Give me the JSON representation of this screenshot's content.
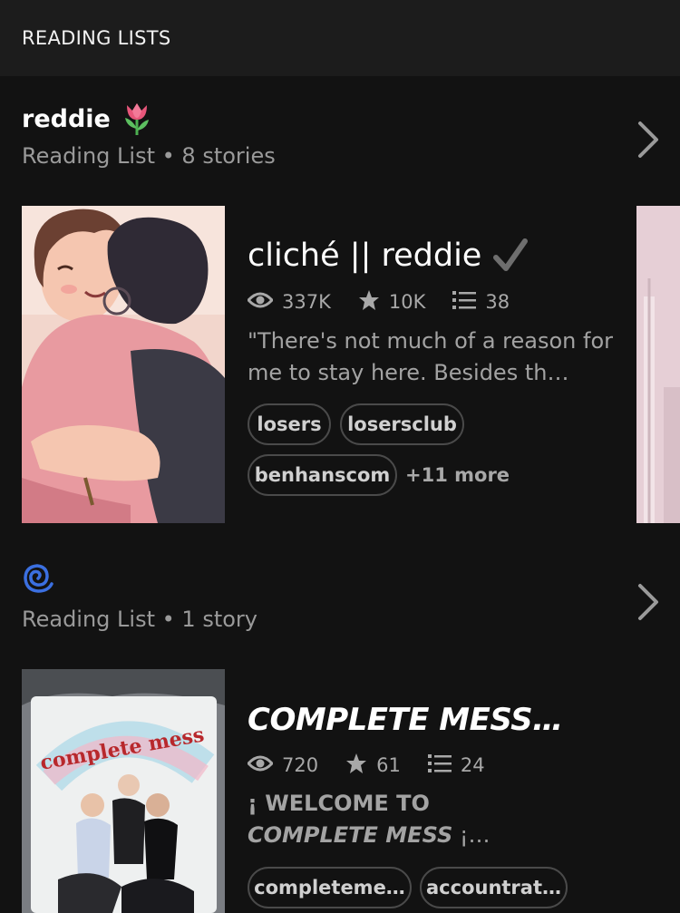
{
  "header": {
    "title": "READING LISTS"
  },
  "lists": [
    {
      "name": "reddie",
      "subtitle": "Reading List • 8 stories",
      "story": {
        "title": "cliché || reddie",
        "reads": "337K",
        "votes": "10K",
        "parts": "38",
        "description": "\"There's not much of a reason for me to stay here. Besides th…",
        "tags": [
          "losers",
          "losersclub",
          "benhanscom"
        ],
        "more_tags": "+11 more"
      }
    },
    {
      "name": "",
      "subtitle": "Reading List • 1 story",
      "story": {
        "title": "COMPLETE MESS…",
        "reads": "720",
        "votes": "61",
        "parts": "24",
        "description_line1": "¡ WELCOME TO",
        "description_line2_em": "COMPLETE MESS",
        "description_line2_tail": " ¡…",
        "tags": [
          "completeme…",
          "accountrat…"
        ],
        "cover_text": "complete mess"
      }
    }
  ],
  "icons": {
    "list1_emoji": "tulip-icon",
    "list2_emoji": "cyclone-icon",
    "reads": "eye-icon",
    "votes": "star-icon",
    "parts": "list-icon",
    "completed": "checkmark-icon",
    "chevron": "chevron-right-icon"
  },
  "colors": {
    "background": "#121212",
    "header": "#1c1c1c",
    "muted_text": "#9a9a9a",
    "tag_border": "#4a4a4a"
  }
}
